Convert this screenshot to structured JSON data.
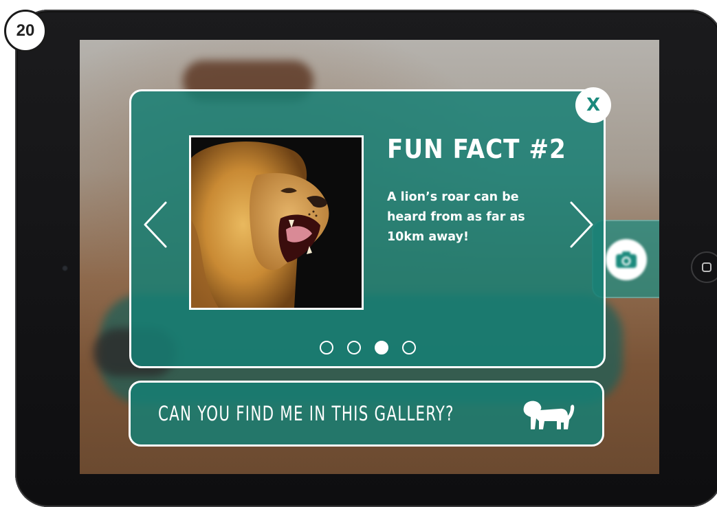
{
  "page_badge": "20",
  "fact_card": {
    "title": "FUN FACT #2",
    "text": "A lion’s roar can be heard from as far as 10km away!",
    "close_label": "X",
    "image": "lion-roaring",
    "carousel": {
      "total": 4,
      "active_index": 2
    }
  },
  "gallery_banner": {
    "text": "CAN YOU FIND ME IN THIS GALLERY?",
    "icon": "lion-silhouette-icon"
  },
  "side_button": {
    "icon": "camera-icon"
  },
  "colors": {
    "accent": "#1b8a7d",
    "panel": "#168075",
    "frame": "#111111"
  }
}
